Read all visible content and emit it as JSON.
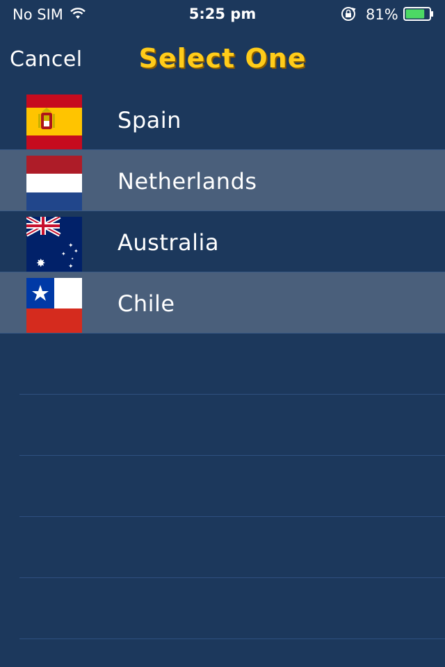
{
  "status_bar": {
    "carrier": "No SIM",
    "time": "5:25 pm",
    "battery_percent": "81%",
    "battery_level": 0.81,
    "icons": [
      "wifi-icon",
      "rotation-lock-icon",
      "battery-icon"
    ]
  },
  "nav": {
    "cancel_label": "Cancel",
    "title": "Select One"
  },
  "countries": [
    {
      "name": "Spain",
      "flag": "spain-flag-icon"
    },
    {
      "name": "Netherlands",
      "flag": "netherlands-flag-icon"
    },
    {
      "name": "Australia",
      "flag": "australia-flag-icon"
    },
    {
      "name": "Chile",
      "flag": "chile-flag-icon"
    }
  ],
  "colors": {
    "background": "#1c385c",
    "alt_row": "#4a5f7b",
    "title": "#ffcc1a",
    "battery": "#4cd964"
  }
}
